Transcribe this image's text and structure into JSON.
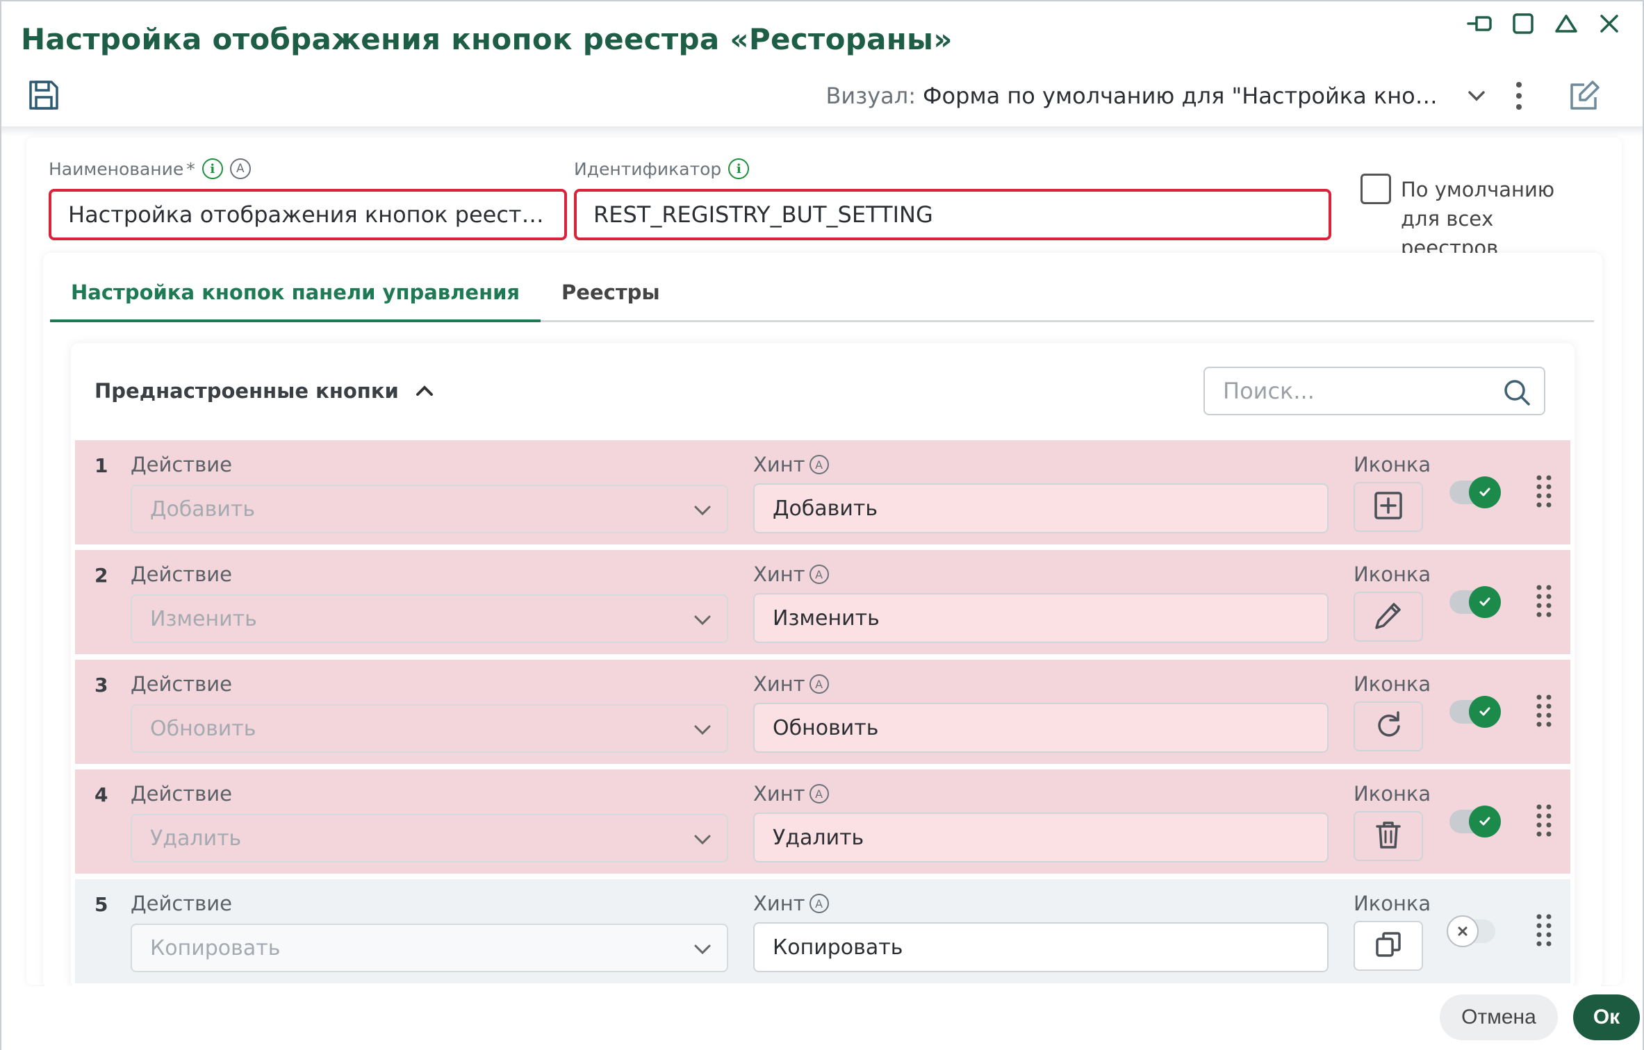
{
  "window": {
    "title": "Настройка отображения кнопок реестра «Рестораны»"
  },
  "toolbar": {
    "visual_label": "Визуал:",
    "visual_value": "Форма по умолчанию для \"Настройка кнопок п..."
  },
  "form": {
    "name_label": "Наименование",
    "name_required_mark": "*",
    "name_value": "Настройка отображения кнопок реестра...",
    "id_label": "Идентификатор",
    "id_value": "REST_REGISTRY_BUT_SETTING",
    "default_checkbox_label": "По умолчанию для всех реестров",
    "default_checkbox_checked": false
  },
  "tabs": [
    {
      "label": "Настройка кнопок панели управления",
      "active": true
    },
    {
      "label": "Реестры",
      "active": false
    }
  ],
  "section": {
    "title": "Преднастроенные кнопки",
    "search_placeholder": "Поиск..."
  },
  "row_labels": {
    "action": "Действие",
    "hint": "Хинт",
    "icon": "Иконка"
  },
  "rows": [
    {
      "num": "1",
      "action": "Добавить",
      "hint": "Добавить",
      "icon": "plus-square-icon",
      "enabled": true
    },
    {
      "num": "2",
      "action": "Изменить",
      "hint": "Изменить",
      "icon": "pencil-icon",
      "enabled": true
    },
    {
      "num": "3",
      "action": "Обновить",
      "hint": "Обновить",
      "icon": "refresh-icon",
      "enabled": true
    },
    {
      "num": "4",
      "action": "Удалить",
      "hint": "Удалить",
      "icon": "trash-icon",
      "enabled": true
    },
    {
      "num": "5",
      "action": "Копировать",
      "hint": "Копировать",
      "icon": "copy-icon",
      "enabled": false
    }
  ],
  "footer": {
    "cancel_label": "Отмена",
    "ok_label": "Ок"
  },
  "colors": {
    "accent": "#1e5e46",
    "error_border": "#d9233b",
    "row_enabled_bg": "#f2d6db",
    "toggle_on": "#1c8a4a"
  }
}
